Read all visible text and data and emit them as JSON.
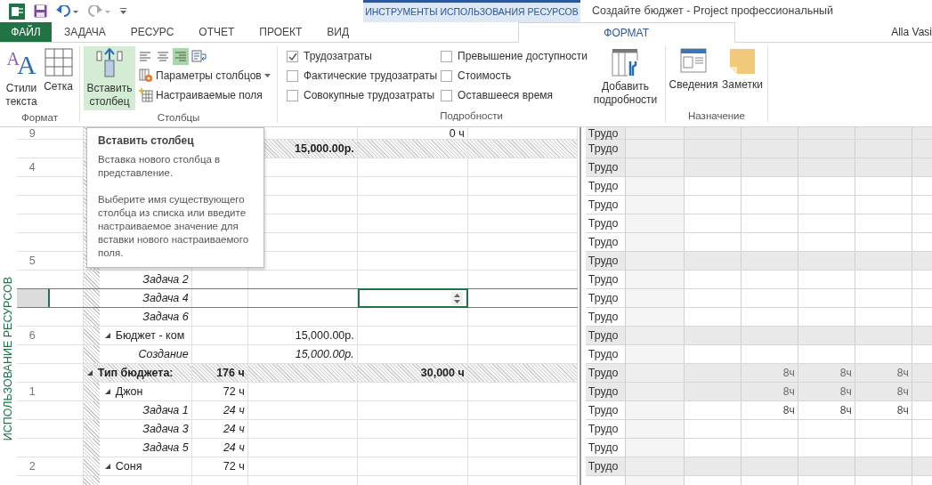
{
  "title_bar": {
    "context_group": "ИНСТРУМЕНТЫ ИСПОЛЬЗОВАНИЯ РЕСУРСОВ",
    "title": "Создайте бюджет - Project профессиональный"
  },
  "tabs": [
    {
      "label": "ФАЙЛ",
      "kind": "file",
      "selected": false
    },
    {
      "label": "ЗАДАЧА",
      "kind": "normal",
      "selected": false
    },
    {
      "label": "РЕСУРС",
      "kind": "normal",
      "selected": false
    },
    {
      "label": "ОТЧЕТ",
      "kind": "normal",
      "selected": false
    },
    {
      "label": "ПРОЕКТ",
      "kind": "normal",
      "selected": false
    },
    {
      "label": "ВИД",
      "kind": "normal",
      "selected": false
    },
    {
      "label": "ФОРМАТ",
      "kind": "context",
      "selected": true
    }
  ],
  "user": "Alla Vasi",
  "ribbon": {
    "format": {
      "label": "Формат",
      "text_styles": {
        "label": "Стили текста",
        "glyphs": [
          "A",
          "A"
        ]
      },
      "gridlines": {
        "label": "Сетка"
      }
    },
    "columns": {
      "label": "Столбцы",
      "insert": {
        "label": "Вставить столбец",
        "highlighted": true
      },
      "align": [
        {
          "selected": false
        },
        {
          "selected": false
        },
        {
          "selected": true
        }
      ],
      "settings": {
        "label": "Параметры столбцов"
      },
      "custom_fields": {
        "label": "Настраиваемые поля"
      }
    },
    "details": {
      "label": "Подробности",
      "checkboxes": [
        {
          "label": "Трудозатраты",
          "checked": true
        },
        {
          "label": "Фактические трудозатраты",
          "checked": false
        },
        {
          "label": "Совокупные трудозатраты",
          "checked": false
        },
        {
          "label": "Превышение доступности",
          "checked": false
        },
        {
          "label": "Стоимость",
          "checked": false
        },
        {
          "label": "Оставшееся время",
          "checked": false
        }
      ],
      "add": {
        "label": "Добавить подробности"
      }
    },
    "assignment": {
      "label": "Назначение",
      "info": {
        "label": "Сведения"
      },
      "notes": {
        "label": "Заметки"
      }
    }
  },
  "side_label": "ИСПОЛЬЗОВАНИЕ РЕСУРСОВ",
  "rows": [
    {
      "kind": "resource",
      "selected": false,
      "id": "9",
      "column_6": "0 ч",
      "detail": "Трудо"
    },
    {
      "kind": "group",
      "selected": false,
      "column_5": "15,000.00р.",
      "detail": "Трудо"
    },
    {
      "kind": "resource",
      "selected": false,
      "id": "4",
      "detail": "Трудо"
    },
    {
      "kind": "assignment",
      "selected": false,
      "detail": "Трудо"
    },
    {
      "kind": "assignment",
      "selected": false,
      "detail": "Трудо"
    },
    {
      "kind": "assignment",
      "selected": false,
      "detail": "Трудо"
    },
    {
      "kind": "assignment",
      "selected": false,
      "detail": "Трудо"
    },
    {
      "kind": "resource",
      "selected": false,
      "id": "5",
      "detail": "Трудо"
    },
    {
      "kind": "assignment",
      "selected": false,
      "name": "Задача 2",
      "detail": "Трудо"
    },
    {
      "kind": "assignment",
      "selected": true,
      "name": "Задача 4",
      "detail": "Трудо"
    },
    {
      "kind": "assignment",
      "selected": false,
      "name": "Задача 6",
      "detail": "Трудо"
    },
    {
      "kind": "resource",
      "selected": false,
      "id": "6",
      "expanded": true,
      "name": "Бюджет - ком",
      "column_5": "15,000.00р.",
      "detail": "Трудо"
    },
    {
      "kind": "assignment",
      "selected": false,
      "name": "Создание",
      "column_5": "15,000.00р.",
      "detail": "Трудо"
    },
    {
      "kind": "group",
      "selected": false,
      "expanded": true,
      "name": "Тип бюджета:",
      "column_4": "176 ч",
      "column_6": "30,000 ч",
      "detail": "Трудо",
      "period_2": "8ч",
      "period_3": "8ч",
      "period_4": "8ч"
    },
    {
      "kind": "resource",
      "selected": false,
      "id": "1",
      "expanded": true,
      "name": "Джон",
      "column_4": "72 ч",
      "detail": "Трудо",
      "period_2": "8ч",
      "period_3": "8ч",
      "period_4": "8ч"
    },
    {
      "kind": "assignment",
      "selected": false,
      "name": "Задача 1",
      "column_4": "24 ч",
      "detail": "Трудо",
      "period_2": "8ч",
      "period_3": "8ч",
      "period_4": "8ч"
    },
    {
      "kind": "assignment",
      "selected": false,
      "name": "Задача 3",
      "column_4": "24 ч",
      "detail": "Трудо"
    },
    {
      "kind": "assignment",
      "selected": false,
      "name": "Задача 5",
      "column_4": "24 ч",
      "detail": "Трудо"
    },
    {
      "kind": "resource",
      "selected": false,
      "id": "2",
      "expanded": true,
      "name": "Соня",
      "column_4": "72 ч",
      "detail": "Трудо"
    },
    {
      "kind": "assignment",
      "selected": false
    }
  ],
  "tooltip": {
    "title": "Вставить столбец",
    "paragraphs": [
      "Вставка нового столбца в представление.",
      "Выберите имя существующего столбца из списка или введите настраиваемое значение для вставки нового настраиваемого поля."
    ]
  }
}
